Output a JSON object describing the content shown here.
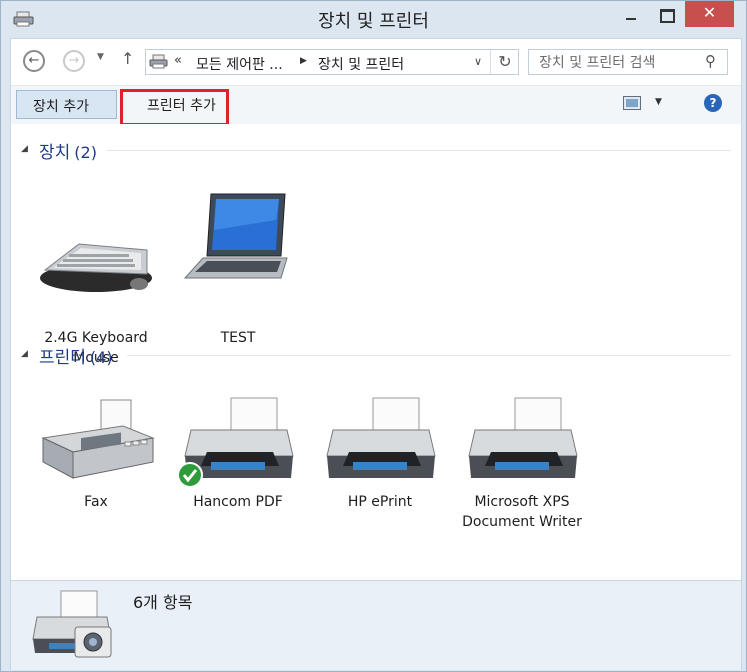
{
  "window": {
    "title": "장치 및 프린터",
    "controls": {
      "minimize": "—",
      "maximize": "□",
      "close": "✕"
    }
  },
  "address_bar": {
    "chevron": "«",
    "crumbs": [
      "모든 제어판 ...",
      "장치 및 프린터"
    ],
    "search_placeholder": "장치 및 프린터 검색"
  },
  "command_bar": {
    "add_device": "장치 추가",
    "add_printer": "프린터 추가",
    "help": "?"
  },
  "groups": [
    {
      "title": "장치",
      "count": "(2)",
      "items": [
        {
          "label": "2.4G Keyboard Mouse",
          "icon": "keyboard-icon"
        },
        {
          "label": "TEST",
          "icon": "laptop-icon"
        }
      ]
    },
    {
      "title": "프린터",
      "count": "(4)",
      "items": [
        {
          "label": "Fax",
          "icon": "fax-icon"
        },
        {
          "label": "Hancom PDF",
          "icon": "printer-icon",
          "default": true
        },
        {
          "label": "HP ePrint",
          "icon": "printer-icon"
        },
        {
          "label": "Microsoft XPS Document Writer",
          "icon": "printer-icon"
        }
      ]
    }
  ],
  "details": {
    "item_count": "6개 항목"
  },
  "colors": {
    "accent": "#1e3a8a",
    "highlight": "#e0202a",
    "close": "#c7504f"
  }
}
